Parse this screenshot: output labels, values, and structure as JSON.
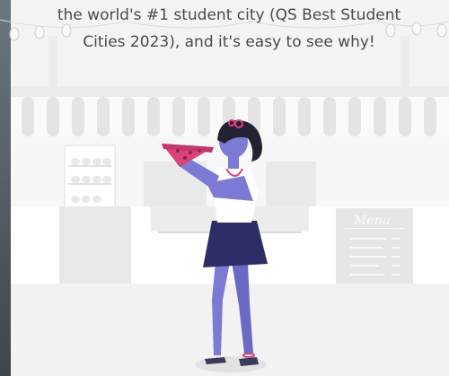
{
  "caption": {
    "line1": "the world's #1 student city (QS Best Student",
    "line2": "Cities 2023), and it's easy to see why!"
  },
  "menu_board": {
    "title": "Menu"
  },
  "icons": {
    "string_lights": "bulb-icon",
    "person": "woman-eating-pizza-illustration"
  },
  "colors": {
    "background": "#f4f4f4",
    "awning_stripe": "#e6e6e6",
    "skirt": "#2f2d66",
    "skin": "#7b7bd6",
    "pizza": "#d9437a",
    "hair": "#222233"
  }
}
